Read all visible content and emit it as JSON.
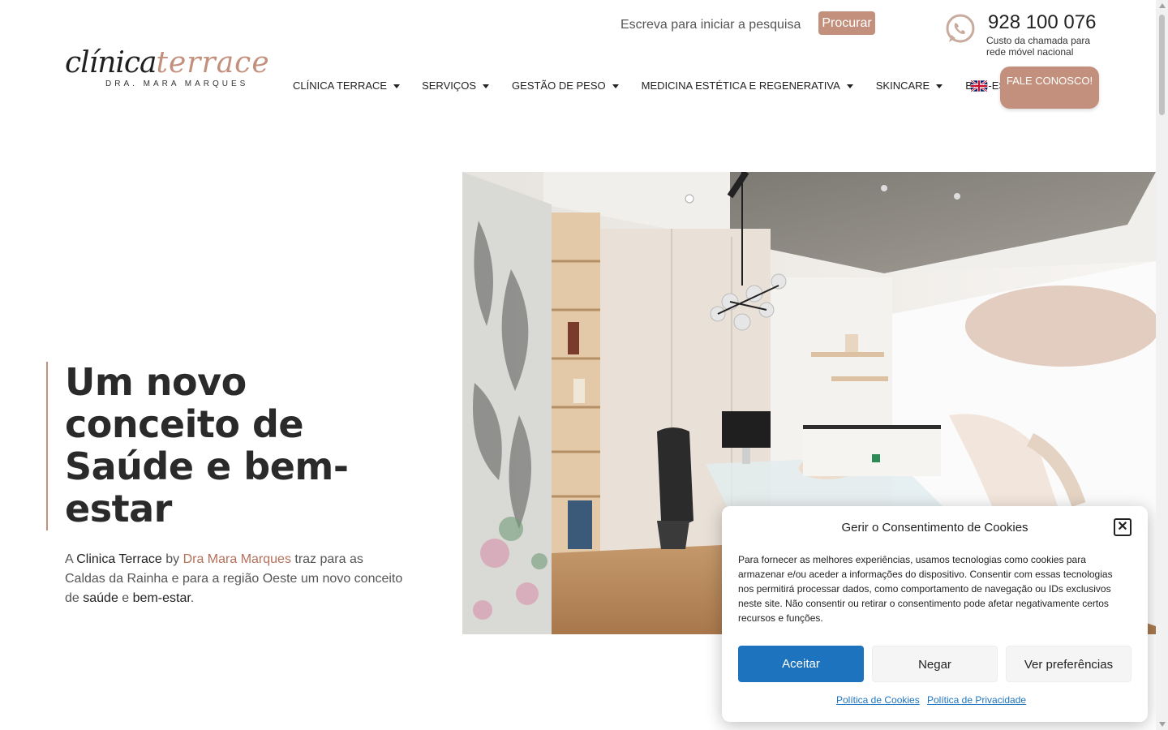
{
  "header": {
    "logo": {
      "main_part1": "clínica",
      "main_part2": "terrace",
      "sub": "DRA. MARA MARQUES"
    },
    "search": {
      "placeholder": "Escreva para iniciar a pesquisa",
      "button_label": "Procurar"
    },
    "contact": {
      "icon": "whatsapp-icon",
      "phone": "928 100 076",
      "note": "Custo da chamada para rede móvel nacional"
    },
    "nav": [
      {
        "label": "CLÍNICA TERRACE"
      },
      {
        "label": "SERVIÇOS"
      },
      {
        "label": "GESTÃO DE PESO"
      },
      {
        "label": "MEDICINA ESTÉTICA E REGENERATIVA"
      },
      {
        "label": "SKINCARE"
      },
      {
        "label": "BEM-ESTAR"
      }
    ],
    "language_flag": "uk-flag-icon",
    "cta_label": "FALE CONOSCO!"
  },
  "hero": {
    "title": "Um novo conceito de Saúde e bem-estar",
    "text": {
      "p1": "A ",
      "b1": "Clinica Terrace",
      "p2": " by ",
      "link": "Dra Mara Marques",
      "p3": " traz para as Caldas da Rainha e para a região Oeste um novo conceito de ",
      "b2": "saúde",
      "p4": " e ",
      "b3": "bem-estar",
      "p5": "."
    }
  },
  "cookie_modal": {
    "title": "Gerir o Consentimento de Cookies",
    "body": "Para fornecer as melhores experiências, usamos tecnologias como cookies para armazenar e/ou aceder a informações do dispositivo. Consentir com essas tecnologias nos permitirá processar dados, como comportamento de navegação ou IDs exclusivos neste site. Não consentir ou retirar o consentimento pode afetar negativamente certos recursos e funções.",
    "accept_label": "Aceitar",
    "deny_label": "Negar",
    "prefs_label": "Ver preferências",
    "cookie_policy_link": "Política de Cookies",
    "privacy_policy_link": "Política de Privacidade"
  },
  "colors": {
    "brand": "#c2907c",
    "accent_text": "#b5705a",
    "primary_button": "#1e73be"
  }
}
